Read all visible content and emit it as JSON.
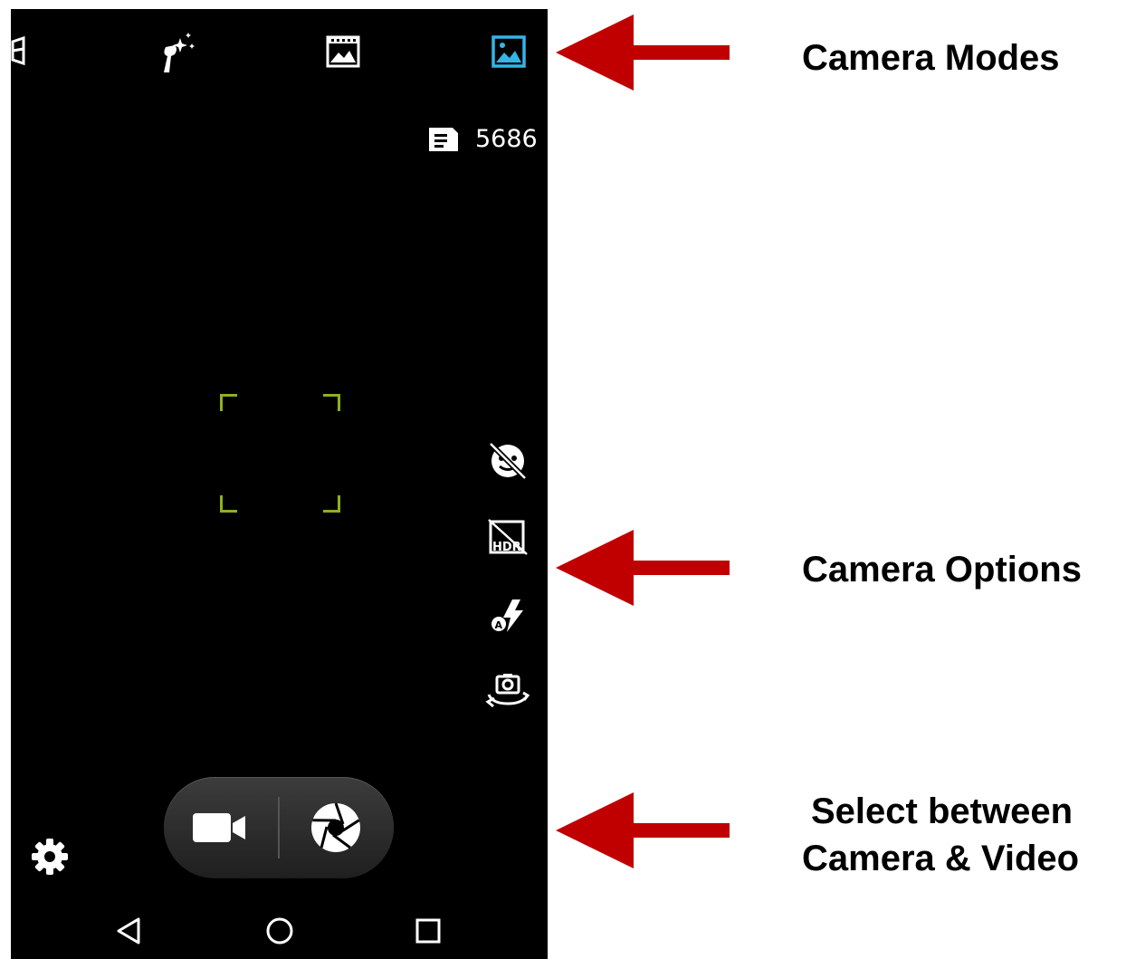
{
  "camera": {
    "remaining_shots": "5686",
    "modes": [
      {
        "icon": "panorama-mode-icon"
      },
      {
        "icon": "beautify-mode-icon"
      },
      {
        "icon": "video-mode-icon"
      },
      {
        "icon": "photo-mode-icon",
        "selected": true
      }
    ],
    "options": [
      {
        "icon": "face-detection-off-icon"
      },
      {
        "icon": "hdr-off-icon"
      },
      {
        "icon": "flash-auto-icon"
      },
      {
        "icon": "switch-camera-icon"
      }
    ],
    "switch": {
      "video_icon": "video-camera-icon",
      "photo_icon": "shutter-icon"
    },
    "settings_icon": "gear-icon",
    "nav": [
      "back-icon",
      "home-icon",
      "recents-icon"
    ]
  },
  "colors": {
    "phone_background": "#000000",
    "selected_mode": "#33b5e5",
    "focus_frame": "#8fb01e",
    "arrow": "#c00000"
  },
  "annotations": {
    "modes_label": "Camera Modes",
    "options_label": "Camera Options",
    "switch_label_line1": "Select between",
    "switch_label_line2": "Camera & Video"
  }
}
